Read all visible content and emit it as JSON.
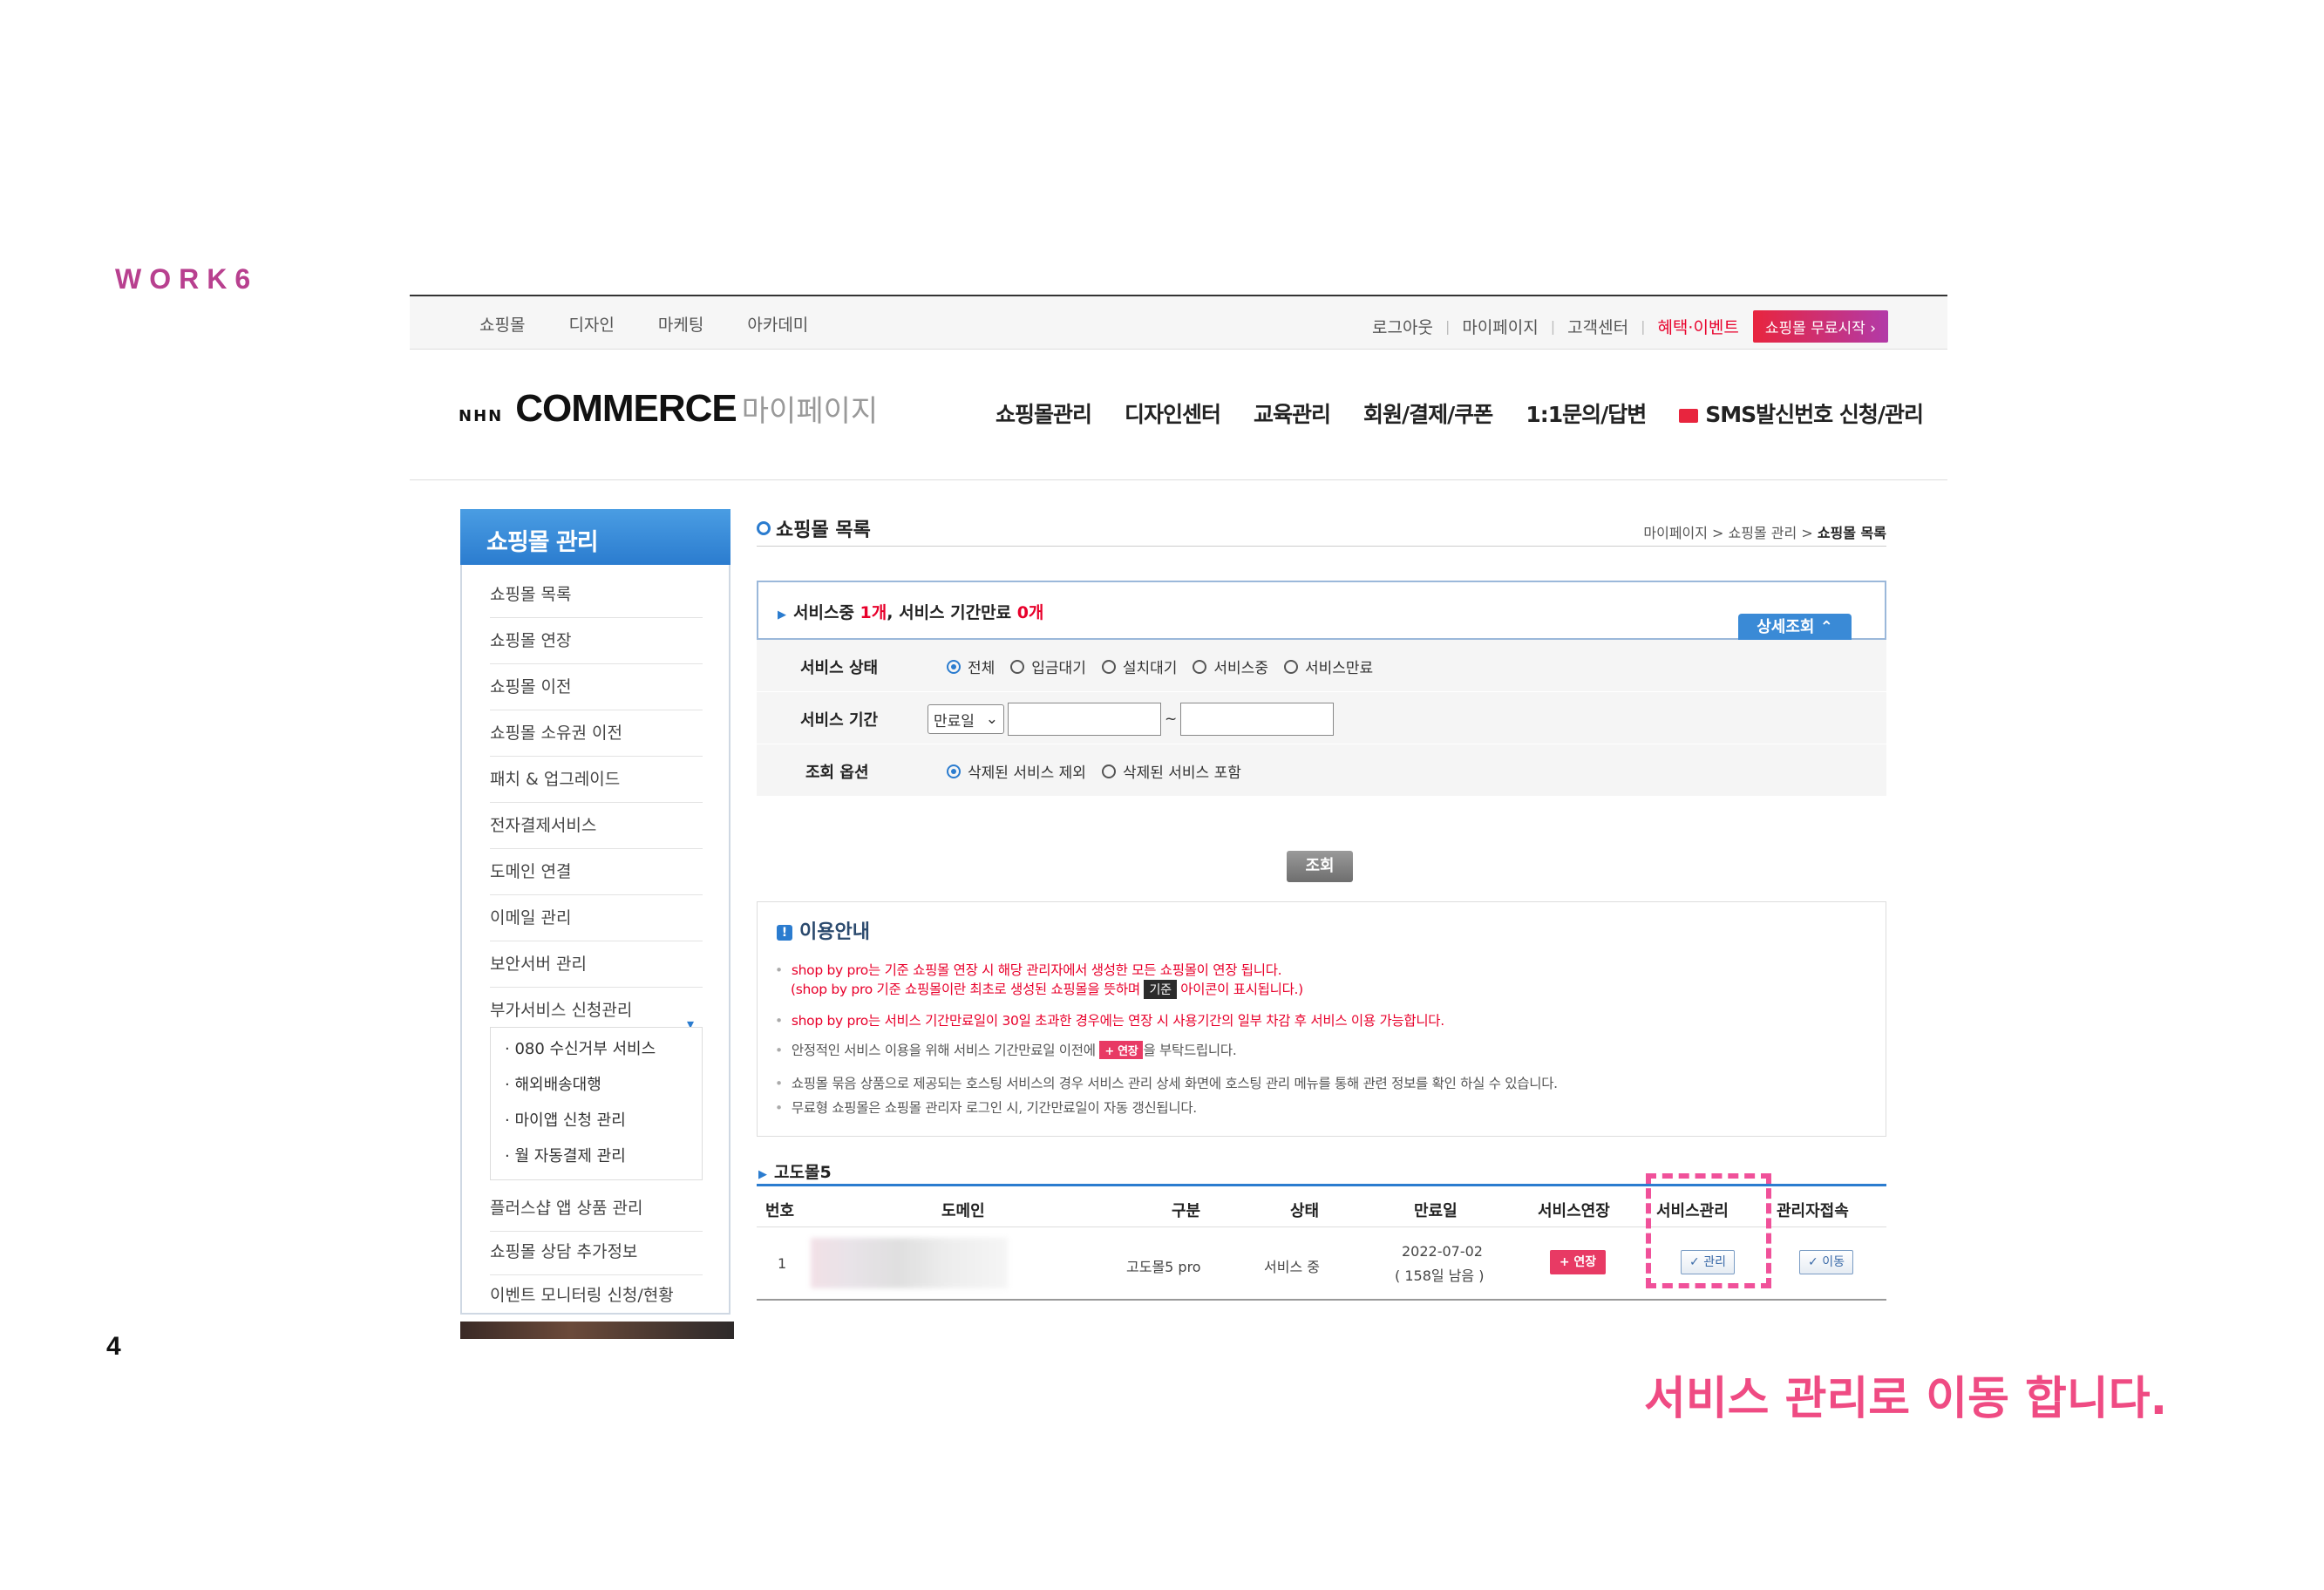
{
  "slide": {
    "work_label": "WORK6",
    "page_number": "4",
    "caption": "서비스 관리로 이동 합니다."
  },
  "gnb": {
    "left_menu": [
      "쇼핑몰",
      "디자인",
      "마케팅",
      "아카데미"
    ],
    "logout": "로그아웃",
    "mypage": "마이페이지",
    "support": "고객센터",
    "event": "혜택·이벤트",
    "start_button": "쇼핑몰 무료시작 ›"
  },
  "header": {
    "logo_nhn": "NHN",
    "logo_commerce": "COMMERCE",
    "logo_mypage": "마이페이지",
    "nav": [
      "쇼핑몰관리",
      "디자인센터",
      "교육관리",
      "회원/결제/쿠폰",
      "1:1문의/답변"
    ],
    "sms": "SMS발신번호 신청/관리"
  },
  "sidebar": {
    "title": "쇼핑몰 관리",
    "items": [
      "쇼핑몰 목록",
      "쇼핑몰 연장",
      "쇼핑몰 이전",
      "쇼핑몰 소유권 이전",
      "패치 & 업그레이드",
      "전자결제서비스",
      "도메인 연결",
      "이메일 관리",
      "보안서버 관리",
      "부가서비스 신청관리"
    ],
    "sub_items": [
      "· 080 수신거부 서비스",
      "· 해외배송대행",
      "· 마이앱 신청 관리",
      "· 월 자동결제 관리"
    ],
    "bottom_items": [
      "플러스샵 앱 상품 관리",
      "쇼핑몰 상담 추가정보",
      "이벤트 모니터링 신청/현황"
    ]
  },
  "content": {
    "title": "쇼핑몰 목록",
    "breadcrumb_prefix": "마이페이지 > 쇼핑몰 관리 > ",
    "breadcrumb_current": "쇼핑몰 목록",
    "summary_a": "서비스중 ",
    "summary_count1": "1개",
    "summary_b": ", 서비스 기간만료 ",
    "summary_count2": "0개",
    "detail_button": "상세조회 ⌃"
  },
  "search_form": {
    "status_label": "서비스 상태",
    "status_options": [
      "전체",
      "입금대기",
      "설치대기",
      "서비스중",
      "서비스만료"
    ],
    "period_label": "서비스 기간",
    "period_select": "만료일",
    "period_sep": "~",
    "option_label": "조회 옵션",
    "option_choices": [
      "삭제된 서비스 제외",
      "삭제된 서비스 포함"
    ],
    "search_button": "조회"
  },
  "notice": {
    "title": "이용안내",
    "line1": "shop by pro는 기준 쇼핑몰 연장 시 해당 관리자에서 생성한 모든 쇼핑몰이 연장 됩니다.",
    "line1b_pre": "(shop by pro 기준 쇼핑몰이란 최초로 생성된 쇼핑몰을 뜻하며 ",
    "line1b_tag": "기준",
    "line1b_post": " 아이콘이 표시됩니다.)",
    "line2": "shop by pro는 서비스 기간만료일이 30일 초과한 경우에는 연장 시 사용기간의 일부 차감 후 서비스 이용 가능합니다.",
    "line3_pre": "안정적인 서비스 이용을 위해 서비스 기간만료일 이전에 ",
    "line3_tag": "+ 연장",
    "line3_post": "을 부탁드립니다.",
    "line4": "쇼핑몰 묶음 상품으로 제공되는 호스팅 서비스의 경우 서비스 관리 상세 화면에 호스팅 관리 메뉴를 통해 관련 정보를 확인 하실 수 있습니다.",
    "line5": "무료형 쇼핑몰은 쇼핑몰 관리자 로그인 시, 기간만료일이 자동 갱신됩니다."
  },
  "table": {
    "section_title": "고도몰5",
    "headers": [
      "번호",
      "도메인",
      "구분",
      "상태",
      "만료일",
      "서비스연장",
      "서비스관리",
      "관리자접속"
    ],
    "row": {
      "no": "1",
      "type": "고도몰5 pro",
      "status": "서비스 중",
      "expiry": "2022-07-02",
      "remaining": "( 158일 남음 )",
      "renew_button": "+ 연장",
      "manage_button": "✓ 관리",
      "access_button": "✓ 이동"
    }
  },
  "colors": {
    "accent": "#2b7ccf",
    "red": "#e8002b",
    "highlight": "#f0519a",
    "label": "#b8408f"
  }
}
